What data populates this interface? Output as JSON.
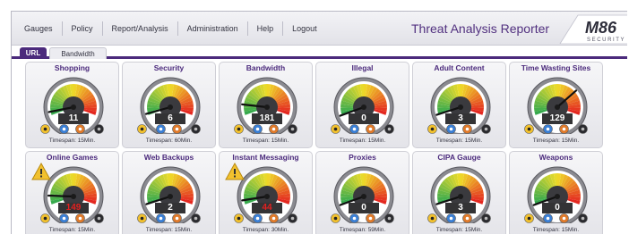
{
  "nav": {
    "items": [
      {
        "label": "Gauges"
      },
      {
        "label": "Policy"
      },
      {
        "label": "Report/Analysis"
      },
      {
        "label": "Administration"
      },
      {
        "label": "Help"
      },
      {
        "label": "Logout"
      }
    ]
  },
  "app": {
    "title": "Threat Analysis Reporter",
    "logo_text": "M86",
    "logo_subtext": "SECURITY"
  },
  "tabs": [
    {
      "label": "URL",
      "active": true
    },
    {
      "label": "Bandwidth",
      "active": false
    }
  ],
  "colors": {
    "brand_purple": "#4b2a7c",
    "gauge_green": "#2fa84f",
    "gauge_red": "#e32020",
    "alert_yellow": "#f2c12e"
  },
  "gauges": [
    {
      "title": "Shopping",
      "value": "11",
      "timespan": "Timespan: 15Min.",
      "level": 0.04,
      "alert": false
    },
    {
      "title": "Security",
      "value": "6",
      "timespan": "Timespan: 60Min.",
      "level": 0.02,
      "alert": false
    },
    {
      "title": "Bandwidth",
      "value": "181",
      "timespan": "Timespan: 15Min.",
      "level": 0.12,
      "alert": false
    },
    {
      "title": "Illegal",
      "value": "0",
      "timespan": "Timespan: 15Min.",
      "level": 0.0,
      "alert": false
    },
    {
      "title": "Adult Content",
      "value": "3",
      "timespan": "Timespan: 15Min.",
      "level": 0.01,
      "alert": false
    },
    {
      "title": "Time Wasting Sites",
      "value": "129",
      "timespan": "Timespan: 15Min.",
      "level": 0.72,
      "alert": false
    },
    {
      "title": "Online Games",
      "value": "149",
      "timespan": "Timespan: 15Min.",
      "level": 0.1,
      "alert": true
    },
    {
      "title": "Web Backups",
      "value": "2",
      "timespan": "Timespan: 15Min.",
      "level": 0.01,
      "alert": false
    },
    {
      "title": "Instant Messaging",
      "value": "44",
      "timespan": "Timespan: 30Min.",
      "level": 0.05,
      "alert": true
    },
    {
      "title": "Proxies",
      "value": "0",
      "timespan": "Timespan: 59Min.",
      "level": 0.0,
      "alert": false
    },
    {
      "title": "CIPA Gauge",
      "value": "3",
      "timespan": "Timespan: 15Min.",
      "level": 0.01,
      "alert": false
    },
    {
      "title": "Weapons",
      "value": "0",
      "timespan": "Timespan: 15Min.",
      "level": 0.0,
      "alert": false
    }
  ],
  "icons": {
    "warning": "warning-icon",
    "drilldown": "drilldown-icon",
    "chart": "chart-icon",
    "color": "color-icon",
    "power": "power-icon"
  }
}
